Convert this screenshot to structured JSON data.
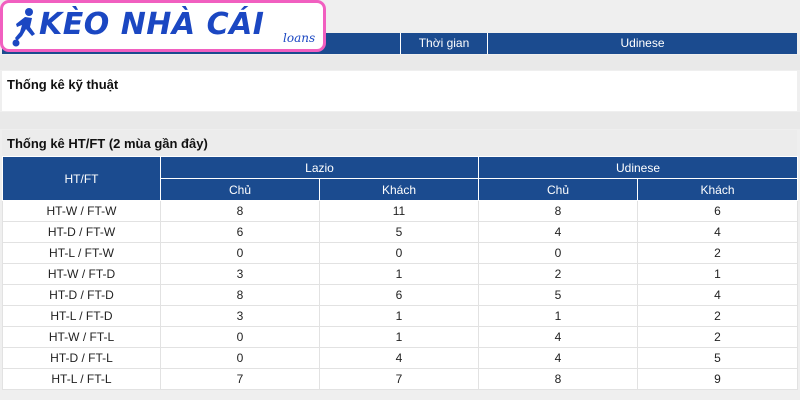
{
  "logo": {
    "text": "KÈO NHÀ CÁI",
    "sub": "loans",
    "icon": "soccer-player-icon"
  },
  "top_header": {
    "col_time": "Thời gian",
    "col_team": "Udinese"
  },
  "sections": {
    "technical": "Thống kê kỹ thuật",
    "htft": "Thống kê HT/FT (2 mùa gần đây)"
  },
  "table": {
    "corner": "HT/FT",
    "team1": "Lazio",
    "team2": "Udinese",
    "home": "Chủ",
    "away": "Khách",
    "rows": [
      {
        "label": "HT-W / FT-W",
        "v": [
          "8",
          "11",
          "8",
          "6"
        ]
      },
      {
        "label": "HT-D / FT-W",
        "v": [
          "6",
          "5",
          "4",
          "4"
        ]
      },
      {
        "label": "HT-L / FT-W",
        "v": [
          "0",
          "0",
          "0",
          "2"
        ]
      },
      {
        "label": "HT-W / FT-D",
        "v": [
          "3",
          "1",
          "2",
          "1"
        ]
      },
      {
        "label": "HT-D / FT-D",
        "v": [
          "8",
          "6",
          "5",
          "4"
        ]
      },
      {
        "label": "HT-L / FT-D",
        "v": [
          "3",
          "1",
          "1",
          "2"
        ]
      },
      {
        "label": "HT-W / FT-L",
        "v": [
          "0",
          "1",
          "4",
          "2"
        ]
      },
      {
        "label": "HT-D / FT-L",
        "v": [
          "0",
          "4",
          "4",
          "5"
        ]
      },
      {
        "label": "HT-L / FT-L",
        "v": [
          "7",
          "7",
          "8",
          "9"
        ]
      }
    ]
  },
  "colors": {
    "header_blue": "#1b4b8f",
    "logo_border": "#f15fc0",
    "logo_text": "#1b47c2"
  }
}
